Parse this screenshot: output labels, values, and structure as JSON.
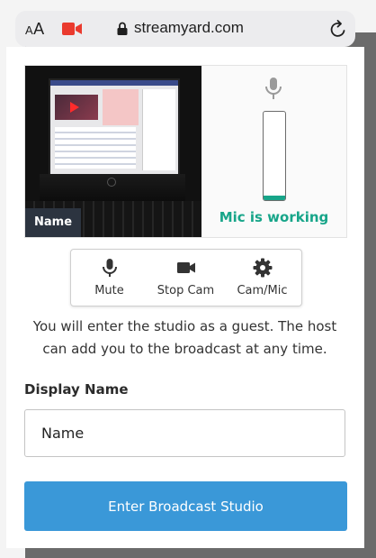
{
  "browser": {
    "text_size_small": "A",
    "text_size_large": "A",
    "url": "streamyard.com",
    "camera_indicator_color": "#ea3a2e"
  },
  "preview": {
    "name_tag": "Name",
    "mic_status": "Mic is working",
    "mic_level": 0.05,
    "accent_color": "#17a589"
  },
  "controls": {
    "mute_label": "Mute",
    "stop_cam_label": "Stop Cam",
    "cam_mic_label": "Cam/Mic"
  },
  "info_text": "You will enter the studio as a guest. The host can add you to the broadcast at any time.",
  "form": {
    "display_name_label": "Display Name",
    "display_name_value": "Name"
  },
  "enter_button": {
    "label": "Enter Broadcast Studio",
    "color": "#3a98d8"
  }
}
